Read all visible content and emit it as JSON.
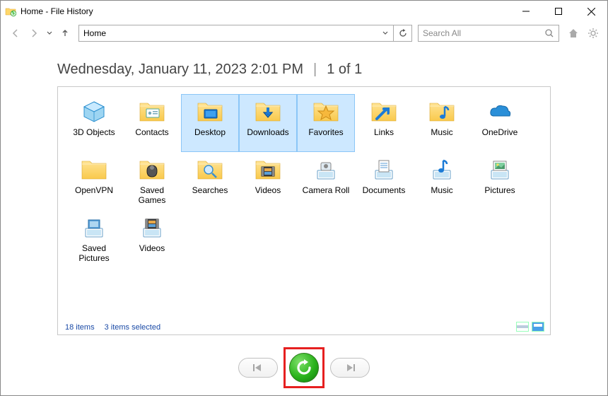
{
  "window": {
    "title": "Home - File History"
  },
  "nav": {
    "address": "Home",
    "search_placeholder": "Search All"
  },
  "heading": {
    "timestamp": "Wednesday, January 11, 2023 2:01 PM",
    "position": "1 of 1"
  },
  "items": [
    {
      "label": "3D Objects",
      "icon": "cube3d",
      "selected": false
    },
    {
      "label": "Contacts",
      "icon": "contact",
      "selected": false
    },
    {
      "label": "Desktop",
      "icon": "desktop",
      "selected": true
    },
    {
      "label": "Downloads",
      "icon": "downloads",
      "selected": true
    },
    {
      "label": "Favorites",
      "icon": "favorites",
      "selected": true
    },
    {
      "label": "Links",
      "icon": "links",
      "selected": false
    },
    {
      "label": "Music",
      "icon": "music",
      "selected": false
    },
    {
      "label": "OneDrive",
      "icon": "onedrive",
      "selected": false
    },
    {
      "label": "OpenVPN",
      "icon": "folder",
      "selected": false
    },
    {
      "label": "Saved Games",
      "icon": "savedgames",
      "selected": false
    },
    {
      "label": "Searches",
      "icon": "searches",
      "selected": false
    },
    {
      "label": "Videos",
      "icon": "videos",
      "selected": false
    },
    {
      "label": "Camera Roll",
      "icon": "cameraroll",
      "selected": false
    },
    {
      "label": "Documents",
      "icon": "documents",
      "selected": false
    },
    {
      "label": "Music",
      "icon": "music2",
      "selected": false
    },
    {
      "label": "Pictures",
      "icon": "pictures",
      "selected": false
    },
    {
      "label": "Saved Pictures",
      "icon": "savedpictures",
      "selected": false
    },
    {
      "label": "Videos",
      "icon": "videos2",
      "selected": false
    }
  ],
  "status": {
    "count": "18 items",
    "selected": "3 items selected"
  }
}
